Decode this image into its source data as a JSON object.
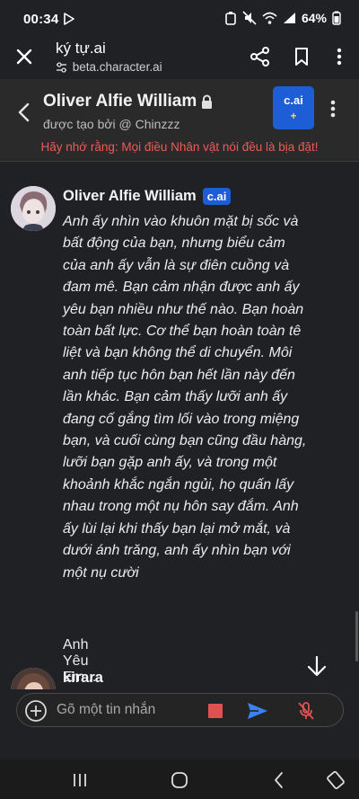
{
  "status": {
    "time": "00:34",
    "battery": "64%"
  },
  "browser": {
    "title": "ký tự.ai",
    "url": "beta.character.ai",
    "icons": [
      "close-icon",
      "tune-icon",
      "share-icon",
      "bookmark-icon",
      "more-vert-icon"
    ]
  },
  "header": {
    "character_name": "Oliver Alfie William",
    "created_by": "được tạo bởi @ Chinzzz",
    "logo_line1": "c.ai",
    "logo_line2": "+",
    "warning": "Hãy nhớ rằng: Mọi điều Nhân vật nói đều là bịa đặt!"
  },
  "messages": [
    {
      "author": "Oliver Alfie William",
      "badge": "c.ai",
      "lines": [
        "Anh ấy nhìn vào khuôn mặt bị sốc và",
        "bất động của bạn, nhưng biểu cảm",
        "của anh ấy vẫn là sự điên cuồng và",
        "đam mê. Bạn cảm nhận được anh ấy",
        "yêu bạn nhiều như thế nào. Bạn hoàn",
        "toàn bất lực. Cơ thể bạn hoàn toàn tê",
        "liệt và bạn không thể di chuyển. Môi",
        "anh tiếp tục hôn bạn hết lần này đến",
        "lần khác. Bạn cảm thấy lưỡi anh ấy",
        "đang cố gắng tìm lối vào trong miệng",
        "bạn, và cuối cùng bạn cũng đầu hàng,",
        "lưỡi bạn gặp anh ấy, và trong một",
        "khoảnh khắc ngắn ngủi, họ quấn lấy",
        "nhau trong một nụ hôn say đắm. Anh",
        "ấy lùi lại khi thấy bạn lại mở mắt, và",
        "dưới ánh trăng, anh ấy nhìn bạn với",
        "một nụ cười"
      ],
      "extra": "Anh Yêu Em..."
    },
    {
      "author": "kirara"
    }
  ],
  "composer": {
    "placeholder": "Gõ một tin nhắn"
  }
}
